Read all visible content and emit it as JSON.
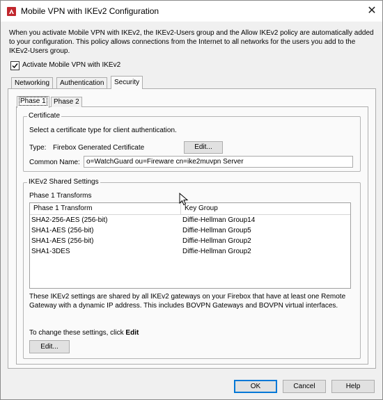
{
  "window": {
    "title": "Mobile VPN with IKEv2 Configuration",
    "close_glyph": "✕"
  },
  "intro_text": "When you activate Mobile VPN with IKEv2, the IKEv2-Users group and the Allow IKEv2 policy are automatically added to your configuration. This policy allows connections from the Internet to all networks for the users you add to the IKEv2-Users group.",
  "activate_checkbox": {
    "label": "Activate Mobile VPN with IKEv2",
    "checked": true
  },
  "tabs": [
    {
      "label": "Networking",
      "active": false
    },
    {
      "label": "Authentication",
      "active": false
    },
    {
      "label": "Security",
      "active": true
    }
  ],
  "subtabs": [
    {
      "label": "Phase 1",
      "active": true
    },
    {
      "label": "Phase 2",
      "active": false
    }
  ],
  "certificate": {
    "legend": "Certificate",
    "instruction": "Select a certificate type for client authentication.",
    "type_label": "Type:",
    "type_value": "Firebox Generated Certificate",
    "edit_label": "Edit...",
    "common_name_label": "Common Name:",
    "common_name_value": "o=WatchGuard ou=Fireware cn=ike2muvpn Server"
  },
  "shared_settings": {
    "legend": "IKEv2 Shared Settings",
    "transforms_label": "Phase 1 Transforms",
    "columns": [
      "Phase 1 Transform",
      "Key Group"
    ],
    "rows": [
      [
        "SHA2-256-AES (256-bit)",
        "Diffie-Hellman Group14"
      ],
      [
        "SHA1-AES (256-bit)",
        "Diffie-Hellman Group5"
      ],
      [
        "SHA1-AES (256-bit)",
        "Diffie-Hellman Group2"
      ],
      [
        "SHA1-3DES",
        "Diffie-Hellman Group2"
      ]
    ],
    "note": "These IKEv2 settings are shared by all IKEv2 gateways on your Firebox that have at least one Remote Gateway with a dynamic IP address. This includes BOVPN Gateways and BOVPN virtual interfaces.",
    "change_prefix": "To change these settings, click ",
    "change_bold": "Edit",
    "edit_label": "Edit..."
  },
  "footer": {
    "ok": "OK",
    "cancel": "Cancel",
    "help": "Help"
  }
}
